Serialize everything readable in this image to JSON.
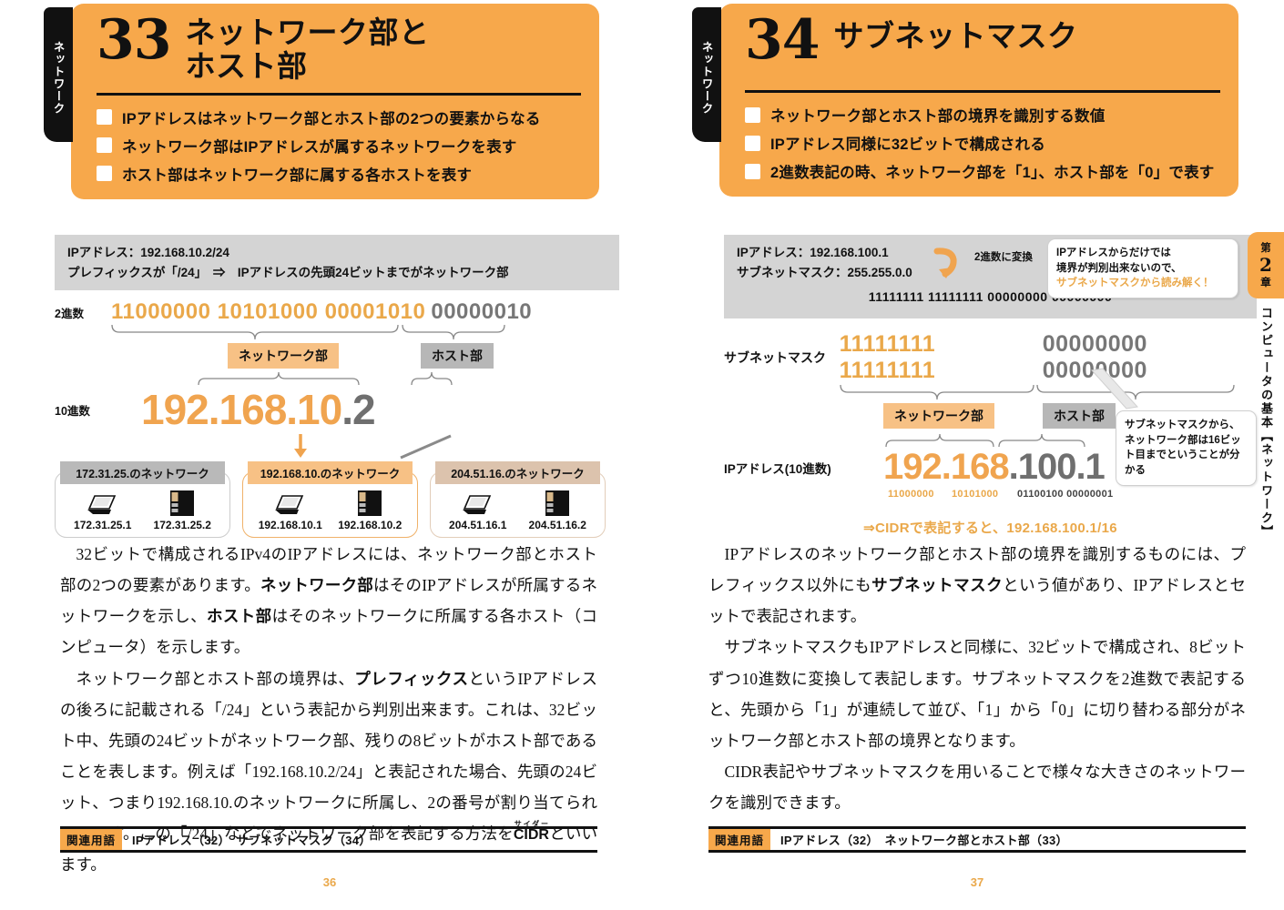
{
  "left_page": {
    "vertical_tab": "ネットワーク",
    "number": "33",
    "title_line1": "ネットワーク部と",
    "title_line2": "ホスト部",
    "bullets": [
      "IPアドレスはネットワーク部とホスト部の2つの要素からなる",
      "ネットワーク部はIPアドレスが属するネットワークを表す",
      "ホスト部はネットワーク部に属する各ホストを表す"
    ],
    "diagram": {
      "band_line1": "IPアドレス：192.168.10.2/24",
      "band_line2": "プレフィックスが「/24」　⇒　IPアドレスの先頭24ビットまでがネットワーク部",
      "binary_label": "2進数",
      "binary_network": "11000000 10101000 00001010",
      "binary_host": "00000010",
      "tag_network": "ネットワーク部",
      "tag_host": "ホスト部",
      "decimal_label": "10進数",
      "decimal_network": "192.168.10",
      "decimal_host": ".2",
      "networks": [
        {
          "title": "172.31.25.のネットワーク",
          "style": "gray",
          "devices": [
            {
              "icon": "laptop-icon",
              "ip": "172.31.25.1"
            },
            {
              "icon": "server-icon",
              "ip": "172.31.25.2"
            }
          ]
        },
        {
          "title": "192.168.10.のネットワーク",
          "style": "orange",
          "devices": [
            {
              "icon": "laptop-icon",
              "ip": "192.168.10.1"
            },
            {
              "icon": "server-icon",
              "ip": "192.168.10.2"
            }
          ]
        },
        {
          "title": "204.51.16.のネットワーク",
          "style": "tan",
          "devices": [
            {
              "icon": "laptop-icon",
              "ip": "204.51.16.1"
            },
            {
              "icon": "server-icon",
              "ip": "204.51.16.2"
            }
          ]
        }
      ]
    },
    "body": {
      "p1_a": "32ビットで構成されるIPv4のIPアドレスには、ネットワーク部とホスト部の2つの要素があります。",
      "p1_b1": "ネットワーク部",
      "p1_c": "はそのIPアドレスが所属するネットワークを示し、",
      "p1_b2": "ホスト部",
      "p1_d": "はそのネットワークに所属する各ホスト（コンピュータ）を示します。",
      "p2_a": "ネットワーク部とホスト部の境界は、",
      "p2_b1": "プレフィックス",
      "p2_c": "というIPアドレスの後ろに記載される「/24」という表記から判別出来ます。これは、32ビット中、先頭の24ビットがネットワーク部、残りの8ビットがホスト部であることを表します。例えば「192.168.10.2/24」と表記された場合、先頭の24ビット、つまり192.168.10.のネットワークに所属し、2の番号が割り当てられています。この「/24」などでネットワーク部を表記する方法を",
      "p2_ruby_base": "CIDR",
      "p2_ruby_text": "サイダー",
      "p2_e": "といいます。"
    },
    "footer": {
      "badge": "関連用語",
      "terms": "IPアドレス（32）　サブネットマスク（34）"
    },
    "page_number": "36"
  },
  "right_page": {
    "vertical_tab": "ネットワーク",
    "number": "34",
    "title_line1": "サブネットマスク",
    "title_line2": "",
    "bullets": [
      "ネットワーク部とホスト部の境界を識別する数値",
      "IPアドレス同様に32ビットで構成される",
      "2進数表記の時、ネットワーク部を「1」、ホスト部を「0」で表す"
    ],
    "diagram": {
      "band_line1": "IPアドレス：192.168.100.1",
      "band_line2": "サブネットマスク：255.255.0.0",
      "convert_note": "2進数に変換",
      "band_binary": "11111111 11111111 00000000 00000000",
      "callout_top_l1": "IPアドレスからだけでは",
      "callout_top_l2": "境界が判別出来ないので、",
      "callout_top_l3": "サブネットマスクから読み解く！",
      "mask_label": "サブネットマスク",
      "mask_network": "11111111 11111111",
      "mask_host": "00000000 00000000",
      "tag_network": "ネットワーク部",
      "tag_host": "ホスト部",
      "callout_side_l1": "サブネットマスクから、",
      "callout_side_l2": "ネットワーク部は16ビッ",
      "callout_side_l3": "ト目までということが分",
      "callout_side_l4": "かる",
      "ip_label": "IPアドレス(10進数)",
      "ip_network": "192.168",
      "ip_host": ".100.1",
      "sub_bits_net1": "11000000",
      "sub_bits_net2": "10101000",
      "sub_bits_host": "01100100 00000001",
      "cidr_note": "⇒CIDRで表記すると、192.168.100.1/16"
    },
    "body": {
      "p1_a": "IPアドレスのネットワーク部とホスト部の境界を識別するものには、プレフィックス以外にも",
      "p1_b1": "サブネットマスク",
      "p1_c": "という値があり、IPアドレスとセットで表記されます。",
      "p2": "サブネットマスクもIPアドレスと同様に、32ビットで構成され、8ビットずつ10進数に変換して表記します。サブネットマスクを2進数で表記すると、先頭から「1」が連続して並び、「1」から「0」に切り替わる部分がネットワーク部とホスト部の境界となります。",
      "p3": "CIDR表記やサブネットマスクを用いることで様々な大きさのネットワークを識別できます。"
    },
    "footer": {
      "badge": "関連用語",
      "terms": "IPアドレス（32）　ネットワーク部とホスト部（33）"
    },
    "page_number": "37"
  },
  "chapter_tab": {
    "line1": "第",
    "line2": "2",
    "line3": "章",
    "body": "コンピュータの基本【ネットワーク】"
  },
  "colors": {
    "orange": "#f7a84b",
    "orange_light": "#f7c185",
    "orange_text": "#eaa84a",
    "gray_band": "#d4d4d4",
    "gray_tag": "#b7b7b7",
    "tan": "#dcc3ad",
    "black": "#111111"
  }
}
